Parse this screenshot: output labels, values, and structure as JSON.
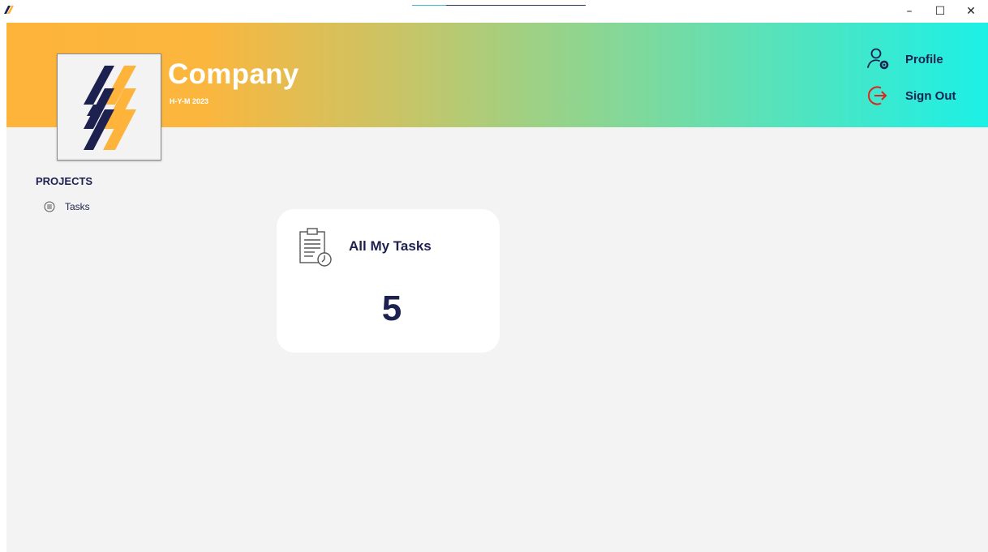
{
  "window": {
    "minimize_glyph": "–",
    "maximize_glyph": "☐",
    "close_glyph": "✕"
  },
  "header": {
    "company_name": "Company",
    "company_subtitle": "H-Y-M 2023",
    "profile_label": "Profile",
    "signout_label": "Sign Out",
    "profile_icon": "user-gear-icon",
    "signout_icon": "sign-out-icon"
  },
  "sidebar": {
    "heading": "PROJECTS",
    "items": [
      {
        "label": "Tasks",
        "icon": "list-circle-icon"
      }
    ]
  },
  "main": {
    "card": {
      "title": "All My Tasks",
      "count": "5",
      "icon": "clipboard-clock-icon"
    }
  },
  "colors": {
    "navy": "#1c2150",
    "orange": "#feb43a",
    "cyan": "#1cf0e6",
    "signout_red": "#e0231c",
    "background": "#f3f3f3"
  }
}
